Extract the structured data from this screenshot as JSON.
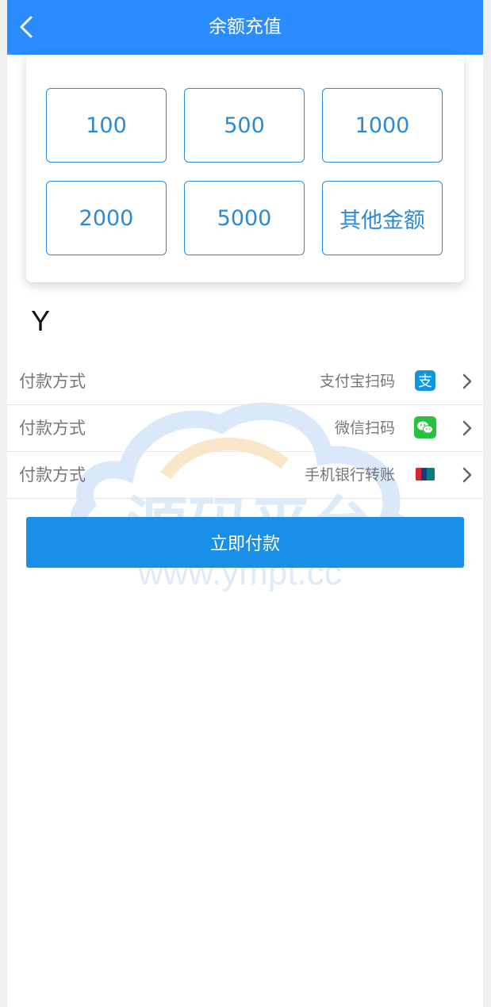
{
  "header": {
    "title": "余额充值"
  },
  "amounts": [
    {
      "label": "100"
    },
    {
      "label": "500"
    },
    {
      "label": "1000"
    },
    {
      "label": "2000"
    },
    {
      "label": "5000"
    },
    {
      "label": "其他金额"
    }
  ],
  "amount_display": "Y",
  "payment_methods": [
    {
      "label": "付款方式",
      "name": "支付宝扫码",
      "icon": "alipay-icon",
      "color": "#1296db"
    },
    {
      "label": "付款方式",
      "name": "微信扫码",
      "icon": "wechat-icon",
      "color": "#29c23f"
    },
    {
      "label": "付款方式",
      "name": "手机银行转账",
      "icon": "unionpay-icon",
      "color": "#d8262f"
    }
  ],
  "submit_label": "立即付款",
  "watermark": {
    "brand": "源码平台",
    "url": "www.ympt.cc"
  },
  "colors": {
    "primary": "#2a8cff",
    "button": "#1a8fe8",
    "amount_border": "#2a8ad6"
  }
}
